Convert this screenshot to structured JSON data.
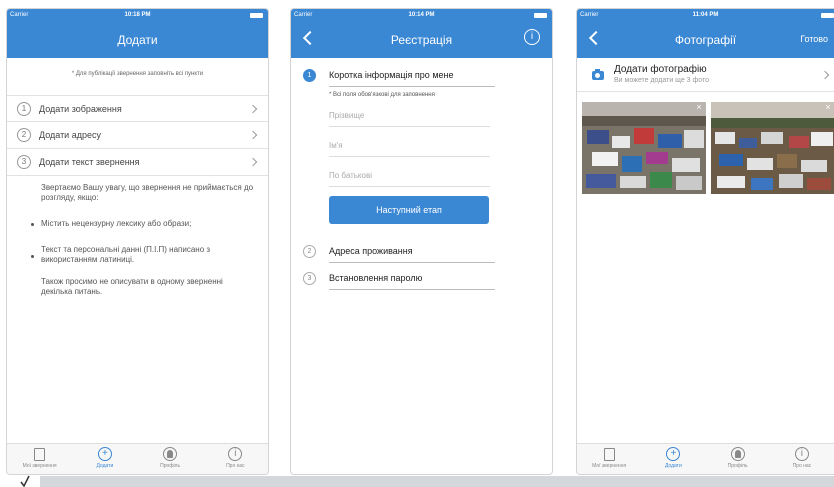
{
  "screen1": {
    "status": {
      "carrier": "Carrier",
      "time": "10:18 PM"
    },
    "nav_title": "Додати",
    "hint": "* Для публікації звернення заповніть всі пункти",
    "steps": [
      {
        "num": "1",
        "label": "Додати зображення"
      },
      {
        "num": "2",
        "label": "Додати адресу"
      },
      {
        "num": "3",
        "label": "Додати текст звернення"
      }
    ],
    "notice_intro": "Звертаємо Вашу увагу, що звернення не приймається до розгляду, якщо:",
    "bullets": [
      "Містить нецензурну лексику або образи;",
      "Текст та персональні данні (П.І.П) написано з використанням латиниці."
    ],
    "notice_outro": "Також просимо не описувати в одному зверненні декілька питань."
  },
  "screen2": {
    "status": {
      "carrier": "Carrier",
      "time": "10:14 PM"
    },
    "nav_title": "Реєстрація",
    "step1": {
      "num": "1",
      "label": "Коротка інформація про мене"
    },
    "required_note": "* Всі поля обов'язкові для заповнення",
    "fields": [
      {
        "placeholder": "Прізвище"
      },
      {
        "placeholder": "Ім'я"
      },
      {
        "placeholder": "По батькові"
      }
    ],
    "next_button": "Наступний етап",
    "step2": {
      "num": "2",
      "label": "Адреса проживання"
    },
    "step3": {
      "num": "3",
      "label": "Встановлення паролю"
    }
  },
  "screen3": {
    "status": {
      "carrier": "Carrier",
      "time": "11:04 PM"
    },
    "nav_title": "Фотографії",
    "done": "Готово",
    "add_photo_title": "Додати фотографію",
    "add_photo_sub": "Ви можете додати ще 3 фото",
    "remove_glyph": "×"
  },
  "tabbar": [
    {
      "label": "Мої звернення",
      "icon": "document-icon"
    },
    {
      "label": "Додати",
      "icon": "plus-circle-icon",
      "active": true
    },
    {
      "label": "Профіль",
      "icon": "profile-icon"
    },
    {
      "label": "Про нас",
      "icon": "info-icon"
    }
  ],
  "colors": {
    "accent": "#3a87d4"
  }
}
